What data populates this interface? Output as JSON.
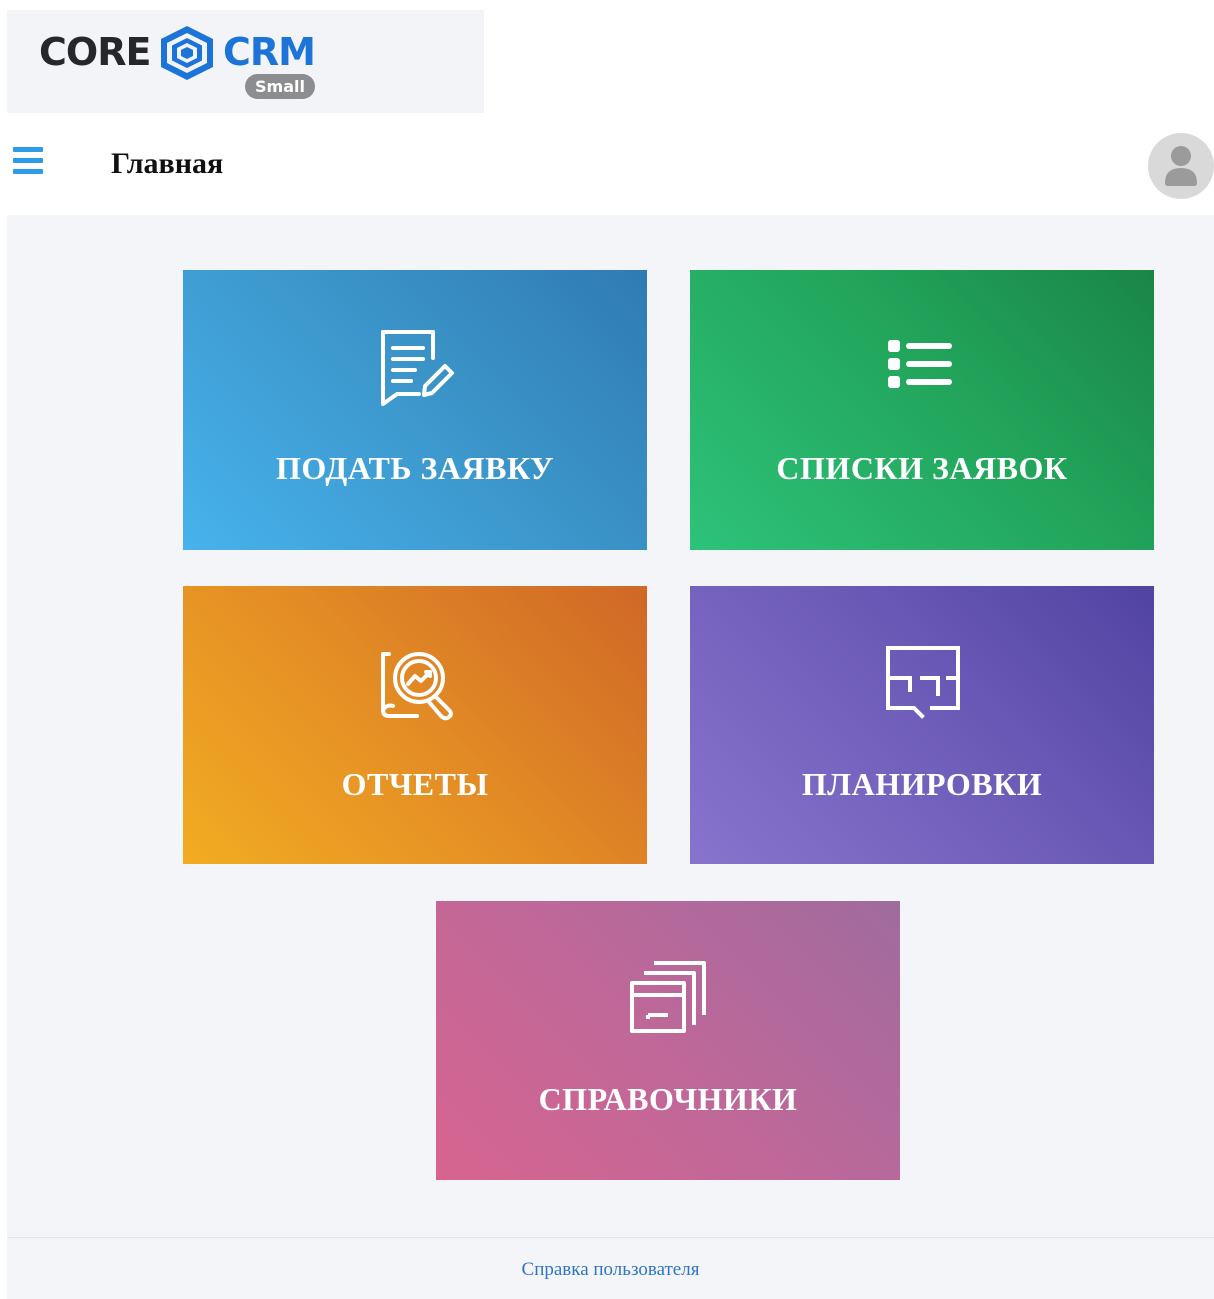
{
  "logo": {
    "core_text": "CORE",
    "crm_text": "CRM",
    "edition_badge": "Small",
    "colors": {
      "core": "#26272b",
      "crm": "#1c73d8",
      "badge": "#8c8d91"
    }
  },
  "header": {
    "menu_icon": "hamburger-menu-icon",
    "title": "Главная",
    "avatar_icon": "user-avatar-icon"
  },
  "tiles": [
    {
      "label": "ПОДАТЬ ЗАЯВКУ",
      "icon": "edit-document-icon",
      "color": "#3a92c6"
    },
    {
      "label": "СПИСКИ ЗАЯВОК",
      "icon": "list-icon",
      "color": "#22a65c"
    },
    {
      "label": "ОТЧЕТЫ",
      "icon": "report-analytics-icon",
      "color": "#e38c25"
    },
    {
      "label": "ПЛАНИРОВКИ",
      "icon": "floor-plan-icon",
      "color": "#6d5bb8"
    },
    {
      "label": "СПРАВОЧНИКИ",
      "icon": "directories-icon",
      "color": "#be6899"
    }
  ],
  "footer": {
    "help_link": "Справка пользователя"
  }
}
